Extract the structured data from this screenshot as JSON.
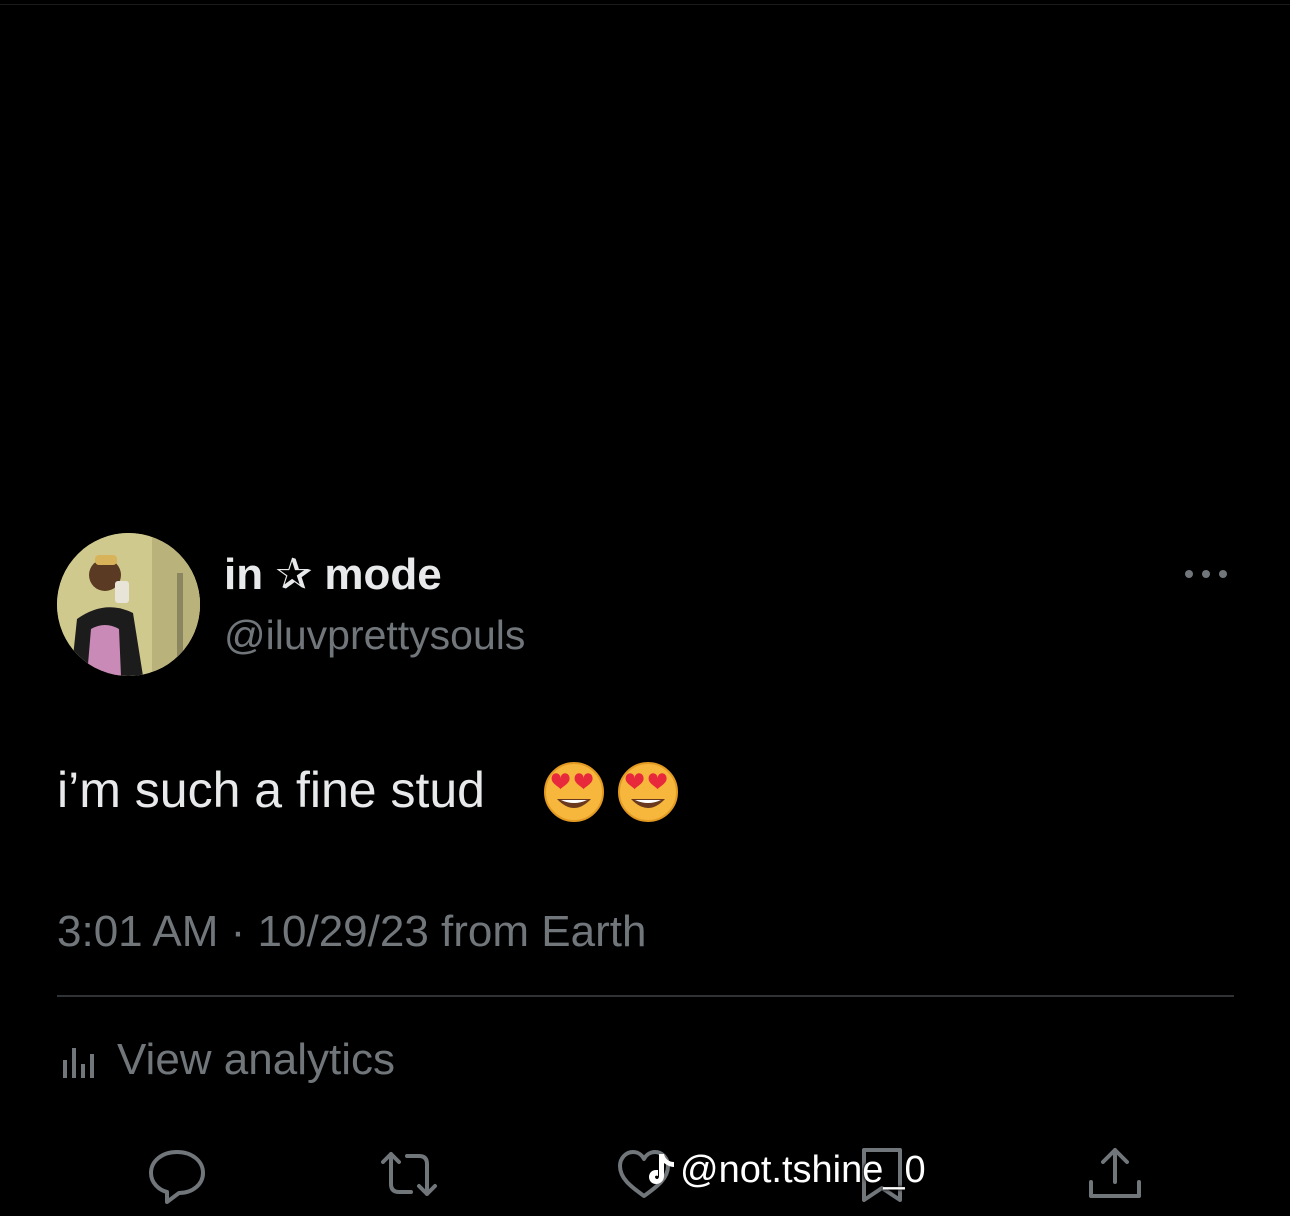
{
  "tweet": {
    "display_name": "in ✰ mode",
    "handle": "@iluvprettysouls",
    "text": "i’m such a fine stud",
    "emojis": [
      "😍",
      "😍"
    ],
    "timestamp": "3:01 AM · 10/29/23 from Earth",
    "analytics_label": "View analytics"
  },
  "overlay": {
    "watermark": "@not.tshine_0"
  },
  "icons": {
    "more": "more-horizontal-icon",
    "analytics": "bar-chart-icon",
    "reply": "reply-bubble-icon",
    "retweet": "retweet-icon",
    "like": "heart-icon",
    "bookmark": "bookmark-icon",
    "share": "share-upload-icon",
    "watermark": "tiktok-icon"
  },
  "colors": {
    "background": "#000000",
    "primary_text": "#e7e9ea",
    "secondary_text": "#71767b",
    "divider": "#2f3336"
  }
}
